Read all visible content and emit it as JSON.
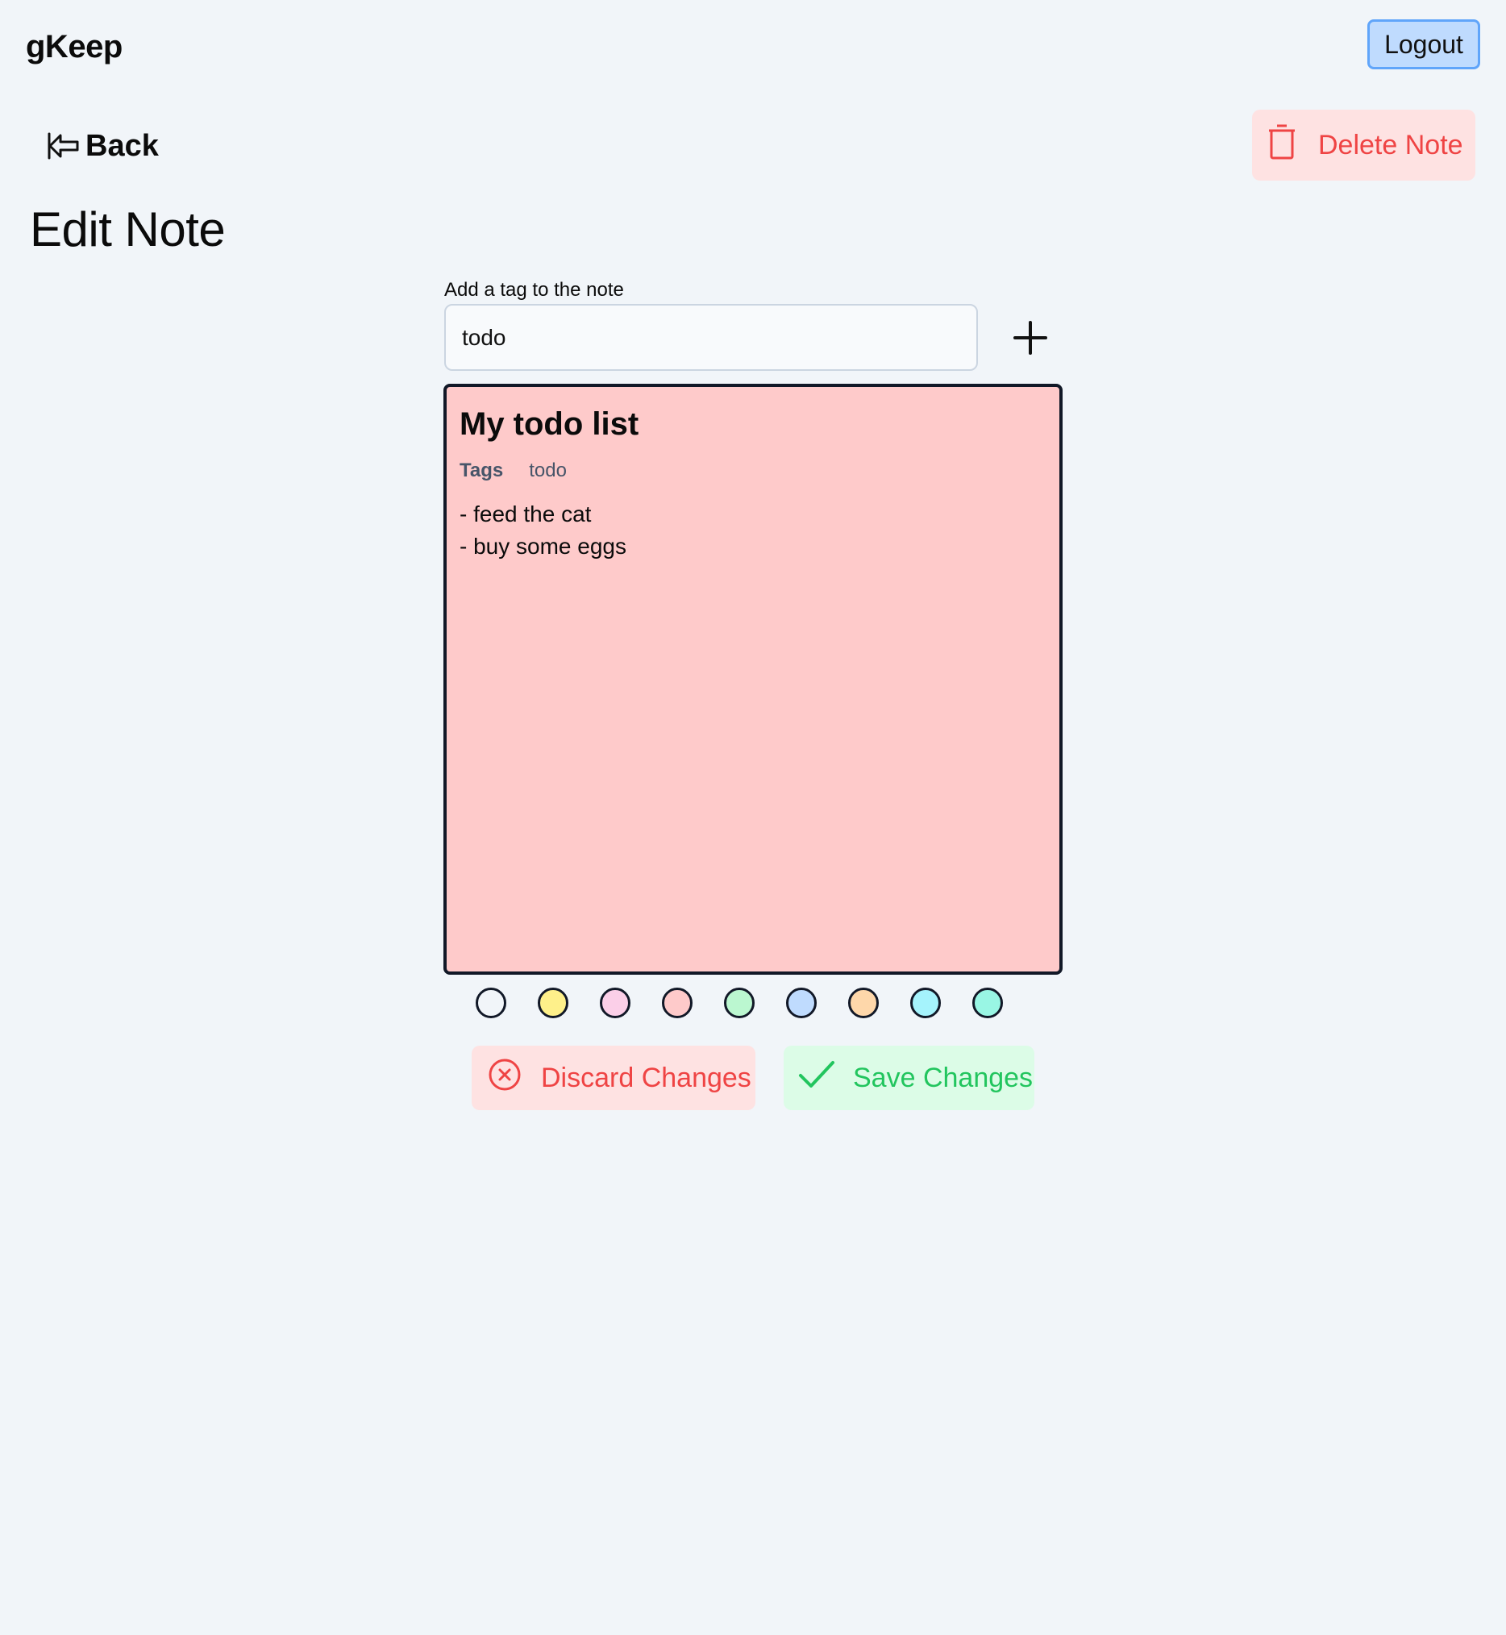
{
  "header": {
    "app_title": "gKeep",
    "logout_label": "Logout"
  },
  "toolbar": {
    "back_label": "Back",
    "back_icon": "arrow-left-icon",
    "delete_label": "Delete Note",
    "delete_icon": "trash-icon"
  },
  "page": {
    "title": "Edit Note"
  },
  "tag_form": {
    "label": "Add a tag to the note",
    "value": "todo",
    "add_icon": "plus-icon"
  },
  "note": {
    "title": "My todo list",
    "tags_label": "Tags",
    "tags": [
      "todo"
    ],
    "lines": [
      "- feed the cat",
      "- buy some eggs"
    ],
    "background_color": "#fecaca",
    "border_color": "#111827"
  },
  "color_options": [
    {
      "name": "gray",
      "color": "#f1f5f9"
    },
    {
      "name": "yellow",
      "color": "#fef08a"
    },
    {
      "name": "pink",
      "color": "#fbcfe8"
    },
    {
      "name": "red",
      "color": "#fecaca"
    },
    {
      "name": "green",
      "color": "#bbf7d0"
    },
    {
      "name": "blue",
      "color": "#bfdbfe"
    },
    {
      "name": "orange",
      "color": "#fed7aa"
    },
    {
      "name": "cyan",
      "color": "#a5f3fc"
    },
    {
      "name": "teal",
      "color": "#99f6e4"
    }
  ],
  "actions": {
    "discard_label": "Discard Changes",
    "discard_icon": "x-circle-icon",
    "save_label": "Save Changes",
    "save_icon": "check-icon"
  },
  "colors": {
    "background": "#f1f5f9",
    "danger": "#ef4444",
    "danger_bg": "#fee2e2",
    "success": "#22c55e",
    "success_bg": "#dcfce7",
    "primary_bg": "#bfdbfe",
    "primary_border": "#60a5fa"
  }
}
